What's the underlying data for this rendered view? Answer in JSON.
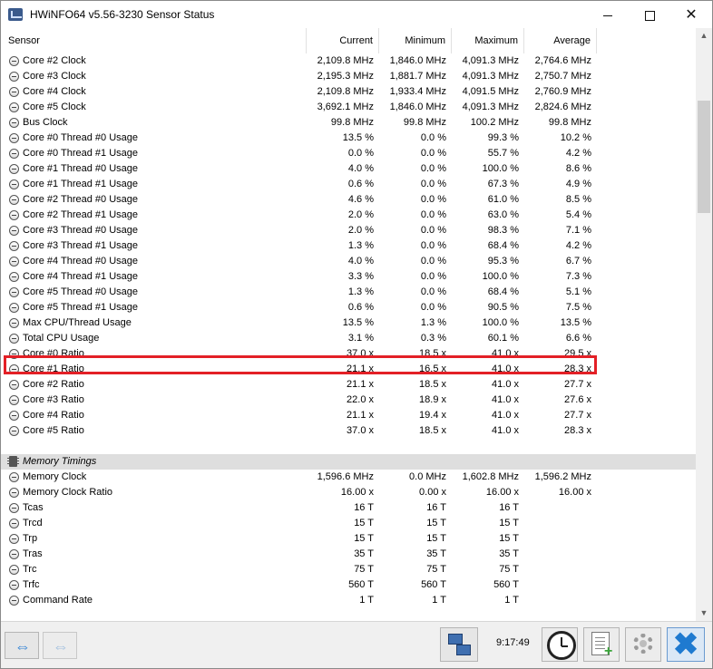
{
  "window": {
    "title": "HWiNFO64 v5.56-3230 Sensor Status"
  },
  "columns": {
    "sensor": "Sensor",
    "current": "Current",
    "minimum": "Minimum",
    "maximum": "Maximum",
    "average": "Average"
  },
  "rows": [
    {
      "type": "sensor",
      "name": "Core #2 Clock",
      "current": "2,109.8 MHz",
      "minimum": "1,846.0 MHz",
      "maximum": "4,091.3 MHz",
      "average": "2,764.6 MHz"
    },
    {
      "type": "sensor",
      "name": "Core #3 Clock",
      "current": "2,195.3 MHz",
      "minimum": "1,881.7 MHz",
      "maximum": "4,091.3 MHz",
      "average": "2,750.7 MHz"
    },
    {
      "type": "sensor",
      "name": "Core #4 Clock",
      "current": "2,109.8 MHz",
      "minimum": "1,933.4 MHz",
      "maximum": "4,091.5 MHz",
      "average": "2,760.9 MHz"
    },
    {
      "type": "sensor",
      "name": "Core #5 Clock",
      "current": "3,692.1 MHz",
      "minimum": "1,846.0 MHz",
      "maximum": "4,091.3 MHz",
      "average": "2,824.6 MHz"
    },
    {
      "type": "sensor",
      "name": "Bus Clock",
      "current": "99.8 MHz",
      "minimum": "99.8 MHz",
      "maximum": "100.2 MHz",
      "average": "99.8 MHz"
    },
    {
      "type": "sensor",
      "name": "Core #0 Thread #0 Usage",
      "current": "13.5 %",
      "minimum": "0.0 %",
      "maximum": "99.3 %",
      "average": "10.2 %"
    },
    {
      "type": "sensor",
      "name": "Core #0 Thread #1 Usage",
      "current": "0.0 %",
      "minimum": "0.0 %",
      "maximum": "55.7 %",
      "average": "4.2 %"
    },
    {
      "type": "sensor",
      "name": "Core #1 Thread #0 Usage",
      "current": "4.0 %",
      "minimum": "0.0 %",
      "maximum": "100.0 %",
      "average": "8.6 %"
    },
    {
      "type": "sensor",
      "name": "Core #1 Thread #1 Usage",
      "current": "0.6 %",
      "minimum": "0.0 %",
      "maximum": "67.3 %",
      "average": "4.9 %"
    },
    {
      "type": "sensor",
      "name": "Core #2 Thread #0 Usage",
      "current": "4.6 %",
      "minimum": "0.0 %",
      "maximum": "61.0 %",
      "average": "8.5 %"
    },
    {
      "type": "sensor",
      "name": "Core #2 Thread #1 Usage",
      "current": "2.0 %",
      "minimum": "0.0 %",
      "maximum": "63.0 %",
      "average": "5.4 %"
    },
    {
      "type": "sensor",
      "name": "Core #3 Thread #0 Usage",
      "current": "2.0 %",
      "minimum": "0.0 %",
      "maximum": "98.3 %",
      "average": "7.1 %"
    },
    {
      "type": "sensor",
      "name": "Core #3 Thread #1 Usage",
      "current": "1.3 %",
      "minimum": "0.0 %",
      "maximum": "68.4 %",
      "average": "4.2 %"
    },
    {
      "type": "sensor",
      "name": "Core #4 Thread #0 Usage",
      "current": "4.0 %",
      "minimum": "0.0 %",
      "maximum": "95.3 %",
      "average": "6.7 %"
    },
    {
      "type": "sensor",
      "name": "Core #4 Thread #1 Usage",
      "current": "3.3 %",
      "minimum": "0.0 %",
      "maximum": "100.0 %",
      "average": "7.3 %"
    },
    {
      "type": "sensor",
      "name": "Core #5 Thread #0 Usage",
      "current": "1.3 %",
      "minimum": "0.0 %",
      "maximum": "68.4 %",
      "average": "5.1 %"
    },
    {
      "type": "sensor",
      "name": "Core #5 Thread #1 Usage",
      "current": "0.6 %",
      "minimum": "0.0 %",
      "maximum": "90.5 %",
      "average": "7.5 %"
    },
    {
      "type": "sensor",
      "name": "Max CPU/Thread Usage",
      "current": "13.5 %",
      "minimum": "1.3 %",
      "maximum": "100.0 %",
      "average": "13.5 %"
    },
    {
      "type": "sensor",
      "name": "Total CPU Usage",
      "current": "3.1 %",
      "minimum": "0.3 %",
      "maximum": "60.1 %",
      "average": "6.6 %",
      "highlighted": true
    },
    {
      "type": "sensor",
      "name": "Core #0 Ratio",
      "current": "37.0 x",
      "minimum": "18.5 x",
      "maximum": "41.0 x",
      "average": "29.5 x"
    },
    {
      "type": "sensor",
      "name": "Core #1 Ratio",
      "current": "21.1 x",
      "minimum": "16.5 x",
      "maximum": "41.0 x",
      "average": "28.3 x"
    },
    {
      "type": "sensor",
      "name": "Core #2 Ratio",
      "current": "21.1 x",
      "minimum": "18.5 x",
      "maximum": "41.0 x",
      "average": "27.7 x"
    },
    {
      "type": "sensor",
      "name": "Core #3 Ratio",
      "current": "22.0 x",
      "minimum": "18.9 x",
      "maximum": "41.0 x",
      "average": "27.6 x"
    },
    {
      "type": "sensor",
      "name": "Core #4 Ratio",
      "current": "21.1 x",
      "minimum": "19.4 x",
      "maximum": "41.0 x",
      "average": "27.7 x"
    },
    {
      "type": "sensor",
      "name": "Core #5 Ratio",
      "current": "37.0 x",
      "minimum": "18.5 x",
      "maximum": "41.0 x",
      "average": "28.3 x"
    },
    {
      "type": "blank"
    },
    {
      "type": "group",
      "name": "Memory Timings"
    },
    {
      "type": "sensor",
      "name": "Memory Clock",
      "current": "1,596.6 MHz",
      "minimum": "0.0 MHz",
      "maximum": "1,602.8 MHz",
      "average": "1,596.2 MHz"
    },
    {
      "type": "sensor",
      "name": "Memory Clock Ratio",
      "current": "16.00 x",
      "minimum": "0.00 x",
      "maximum": "16.00 x",
      "average": "16.00 x"
    },
    {
      "type": "sensor",
      "name": "Tcas",
      "current": "16 T",
      "minimum": "16 T",
      "maximum": "16 T",
      "average": ""
    },
    {
      "type": "sensor",
      "name": "Trcd",
      "current": "15 T",
      "minimum": "15 T",
      "maximum": "15 T",
      "average": ""
    },
    {
      "type": "sensor",
      "name": "Trp",
      "current": "15 T",
      "minimum": "15 T",
      "maximum": "15 T",
      "average": ""
    },
    {
      "type": "sensor",
      "name": "Tras",
      "current": "35 T",
      "minimum": "35 T",
      "maximum": "35 T",
      "average": ""
    },
    {
      "type": "sensor",
      "name": "Trc",
      "current": "75 T",
      "minimum": "75 T",
      "maximum": "75 T",
      "average": ""
    },
    {
      "type": "sensor",
      "name": "Trfc",
      "current": "560 T",
      "minimum": "560 T",
      "maximum": "560 T",
      "average": ""
    },
    {
      "type": "sensor",
      "name": "Command Rate",
      "current": "1 T",
      "minimum": "1 T",
      "maximum": "1 T",
      "average": ""
    }
  ],
  "statusbar": {
    "time": "9:17:49"
  },
  "colors": {
    "highlight": "#e32026",
    "group_bg": "#dedede",
    "accent": "#1f7ad0"
  }
}
